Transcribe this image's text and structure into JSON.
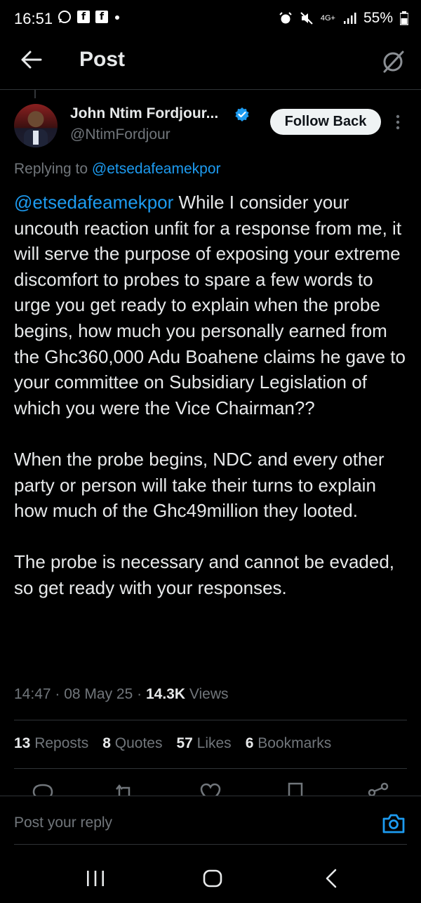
{
  "status_bar": {
    "time": "16:51",
    "network": "4G+",
    "battery": "55%"
  },
  "header": {
    "title": "Post"
  },
  "author": {
    "name": "John Ntim Fordjour...",
    "handle": "@NtimFordjour",
    "follow_label": "Follow Back"
  },
  "replying": {
    "prefix": "Replying to ",
    "mention": "@etsedafeamekpor"
  },
  "tweet": {
    "mention": "@etsedafeamekpor",
    "text": " While I consider your uncouth reaction unfit for a response from me, it will serve the purpose of exposing your extreme discomfort to probes to spare a few words to urge you get ready to explain when the probe begins, how much you personally earned from the Ghc360,000 Adu Boahene claims he gave to your committee on Subsidiary Legislation of which you were the Vice Chairman??\n\nWhen the probe begins, NDC and every other party or person will take their turns to explain how much of the Ghc49million they looted.\n\nThe probe is necessary and cannot be evaded, so get ready with your responses."
  },
  "meta": {
    "time": "14:47",
    "dot1": " · ",
    "date": "08 May 25",
    "dot2": " · ",
    "views_count": "14.3K",
    "views_label": " Views"
  },
  "stats": {
    "reposts_count": "13",
    "reposts_label": " Reposts",
    "quotes_count": "8",
    "quotes_label": " Quotes",
    "likes_count": "57",
    "likes_label": " Likes",
    "bookmarks_count": "6",
    "bookmarks_label": " Bookmarks"
  },
  "reply_box": {
    "placeholder": "Post your reply"
  },
  "colors": {
    "background": "#000000",
    "accent": "#1d9bf0",
    "secondary_text": "#71767b",
    "primary_text": "#e7e9ea"
  }
}
